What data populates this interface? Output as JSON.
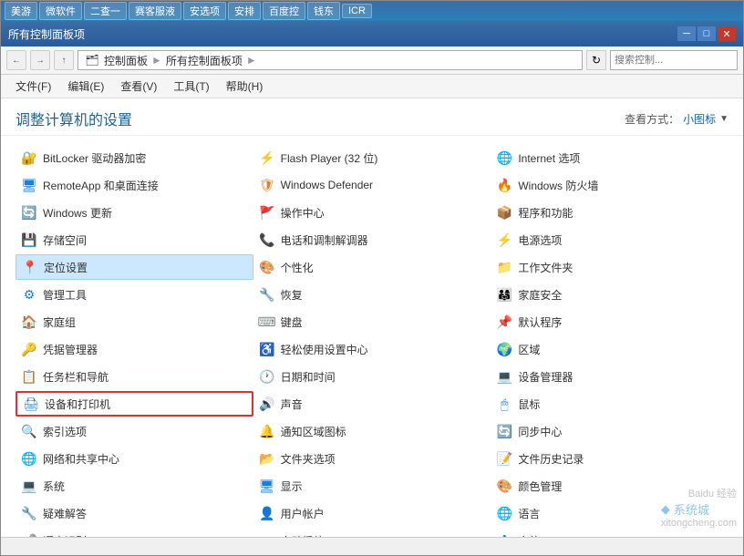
{
  "taskbar": {
    "items": [
      "美游",
      "微软件",
      "二查一",
      "赛客服液",
      "安选项",
      "安排",
      "百度控",
      "钱东",
      "ICR"
    ]
  },
  "titlebar": {
    "title": "所有控制面板项",
    "minimize": "─",
    "maximize": "□",
    "close": "✕"
  },
  "addressbar": {
    "path1": "控制面板",
    "path2": "所有控制面板项",
    "search_placeholder": "搜索控制..."
  },
  "menubar": {
    "items": [
      "文件(F)",
      "编辑(E)",
      "查看(V)",
      "工具(T)",
      "帮助(H)"
    ]
  },
  "content": {
    "title": "调整计算机的设置",
    "view_label": "查看方式：",
    "view_mode": "小图标",
    "items": [
      {
        "id": "bitlocker",
        "icon": "🔐",
        "label": "BitLocker 驱动器加密",
        "col": 0
      },
      {
        "id": "flash",
        "icon": "⚡",
        "label": "Flash Player (32 位)",
        "col": 1
      },
      {
        "id": "internet-options",
        "icon": "🌐",
        "label": "Internet 选项",
        "col": 2
      },
      {
        "id": "remoteapp",
        "icon": "🖥",
        "label": "RemoteApp 和桌面连接",
        "col": 0
      },
      {
        "id": "defender",
        "icon": "🛡",
        "label": "Windows Defender",
        "col": 1
      },
      {
        "id": "firewall",
        "icon": "🔥",
        "label": "Windows 防火墙",
        "col": 2
      },
      {
        "id": "update",
        "icon": "🔄",
        "label": "Windows 更新",
        "col": 0
      },
      {
        "id": "action-center",
        "icon": "🚩",
        "label": "操作中心",
        "col": 1
      },
      {
        "id": "programs",
        "icon": "📦",
        "label": "程序和功能",
        "col": 2
      },
      {
        "id": "storage",
        "icon": "💾",
        "label": "存储空间",
        "col": 0
      },
      {
        "id": "phone-modem",
        "icon": "📞",
        "label": "电话和调制解调器",
        "col": 1
      },
      {
        "id": "power",
        "icon": "⚡",
        "label": "电源选项",
        "col": 2
      },
      {
        "id": "location",
        "icon": "📍",
        "label": "定位设置",
        "col": 0,
        "selected": true
      },
      {
        "id": "personalize",
        "icon": "🎨",
        "label": "个性化",
        "col": 1
      },
      {
        "id": "work-folder",
        "icon": "📁",
        "label": "工作文件夹",
        "col": 2
      },
      {
        "id": "admin-tools",
        "icon": "⚙",
        "label": "管理工具",
        "col": 0
      },
      {
        "id": "recovery",
        "icon": "🔧",
        "label": "恢复",
        "col": 1
      },
      {
        "id": "family-safety",
        "icon": "👨‍👩‍👧",
        "label": "家庭安全",
        "col": 2
      },
      {
        "id": "homegroup",
        "icon": "🏠",
        "label": "家庭组",
        "col": 0
      },
      {
        "id": "keyboard",
        "icon": "⌨",
        "label": "键盘",
        "col": 1
      },
      {
        "id": "default-programs",
        "icon": "📌",
        "label": "默认程序",
        "col": 2
      },
      {
        "id": "credential-mgr",
        "icon": "🔑",
        "label": "凭据管理器",
        "col": 0
      },
      {
        "id": "ease-access",
        "icon": "♿",
        "label": "轻松使用设置中心",
        "col": 1
      },
      {
        "id": "region",
        "icon": "🌍",
        "label": "区域",
        "col": 2
      },
      {
        "id": "taskbar-nav",
        "icon": "📋",
        "label": "任务栏和导航",
        "col": 0
      },
      {
        "id": "datetime",
        "icon": "🕐",
        "label": "日期和时间",
        "col": 1
      },
      {
        "id": "device-mgr",
        "icon": "💻",
        "label": "设备管理器",
        "col": 2
      },
      {
        "id": "devices-printers",
        "icon": "🖨",
        "label": "设备和打印机",
        "col": 0,
        "highlighted": true
      },
      {
        "id": "sound",
        "icon": "🔊",
        "label": "声音",
        "col": 1
      },
      {
        "id": "mouse",
        "icon": "🖱",
        "label": "鼠标",
        "col": 2
      },
      {
        "id": "index-options",
        "icon": "🔍",
        "label": "索引选项",
        "col": 0
      },
      {
        "id": "notif-area",
        "icon": "🔔",
        "label": "通知区域图标",
        "col": 1
      },
      {
        "id": "sync-center",
        "icon": "🔄",
        "label": "同步中心",
        "col": 2
      },
      {
        "id": "network-sharing",
        "icon": "🌐",
        "label": "网络和共享中心",
        "col": 0
      },
      {
        "id": "folder-options",
        "icon": "📂",
        "label": "文件夹选项",
        "col": 1
      },
      {
        "id": "file-history",
        "icon": "📝",
        "label": "文件历史记录",
        "col": 2
      },
      {
        "id": "system",
        "icon": "💻",
        "label": "系统",
        "col": 0
      },
      {
        "id": "display",
        "icon": "🖥",
        "label": "显示",
        "col": 1
      },
      {
        "id": "color-mgmt",
        "icon": "🎨",
        "label": "颜色管理",
        "col": 2
      },
      {
        "id": "troubleshoot",
        "icon": "🔧",
        "label": "疑难解答",
        "col": 0
      },
      {
        "id": "user-accounts",
        "icon": "👤",
        "label": "用户帐户",
        "col": 1
      },
      {
        "id": "language",
        "icon": "🌐",
        "label": "语言",
        "col": 2
      },
      {
        "id": "speech",
        "icon": "🎤",
        "label": "语音识别",
        "col": 0
      },
      {
        "id": "autoplay",
        "icon": "▶",
        "label": "自动播放",
        "col": 1
      },
      {
        "id": "fonts",
        "icon": "A",
        "label": "字体",
        "col": 2
      }
    ]
  },
  "statusbar": {
    "text": ""
  }
}
